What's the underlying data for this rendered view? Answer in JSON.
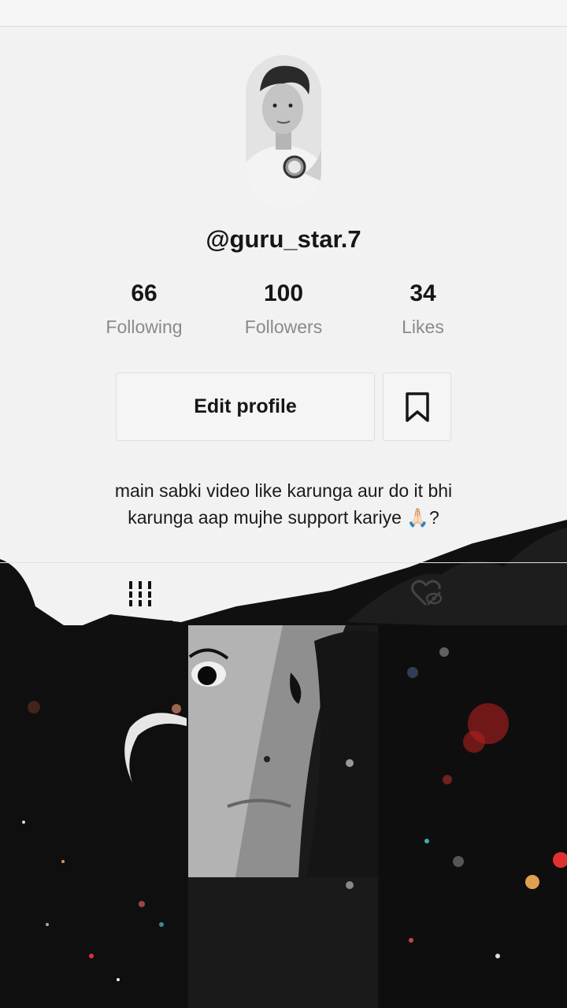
{
  "profile": {
    "username": "@guru_star.7",
    "bio_line1": "main sabki video like karunga aur do it bhi",
    "bio_line2": "karunga aap mujhe support kariye 🙏🏻?"
  },
  "stats": {
    "following": {
      "value": "66",
      "label": "Following"
    },
    "followers": {
      "value": "100",
      "label": "Followers"
    },
    "likes": {
      "value": "34",
      "label": "Likes"
    }
  },
  "actions": {
    "edit_profile_label": "Edit profile",
    "bookmark_icon": "bookmark-icon"
  },
  "tabs": [
    {
      "icon": "grid-icon",
      "active": true
    },
    {
      "icon": "liked-private-icon",
      "active": false
    }
  ],
  "videos": [
    {
      "thumb": "dark-sparkle-heart"
    },
    {
      "thumb": "face-portrait"
    },
    {
      "thumb": "dark-sparkle"
    }
  ],
  "colors": {
    "background": "#f2f2f2",
    "text_primary": "#161616",
    "text_secondary": "#8a8a8a",
    "dark_area": "#111111"
  }
}
